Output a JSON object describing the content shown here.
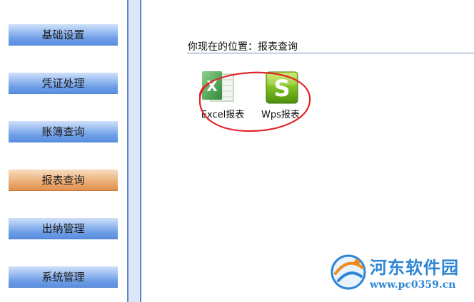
{
  "sidebar": {
    "items": [
      {
        "label": "基础设置",
        "active": false
      },
      {
        "label": "凭证处理",
        "active": false
      },
      {
        "label": "账簿查询",
        "active": false
      },
      {
        "label": "报表查询",
        "active": true
      },
      {
        "label": "出纳管理",
        "active": false
      },
      {
        "label": "系统管理",
        "active": false
      }
    ]
  },
  "content": {
    "breadcrumb": "你现在的位置：报表查询",
    "tiles": [
      {
        "label": "Excel报表",
        "icon": "excel-icon"
      },
      {
        "label": "Wps报表",
        "icon": "wps-icon"
      }
    ]
  },
  "watermark": {
    "name": "河东软件园",
    "url": "www.pc0359.cn"
  },
  "colors": {
    "nav_blue": "#6d9de6",
    "nav_active_orange": "#e8a266",
    "splitter_blue": "#5b86c9",
    "highlight_red": "#e0262b",
    "watermark_blue": "#2f86d4"
  }
}
